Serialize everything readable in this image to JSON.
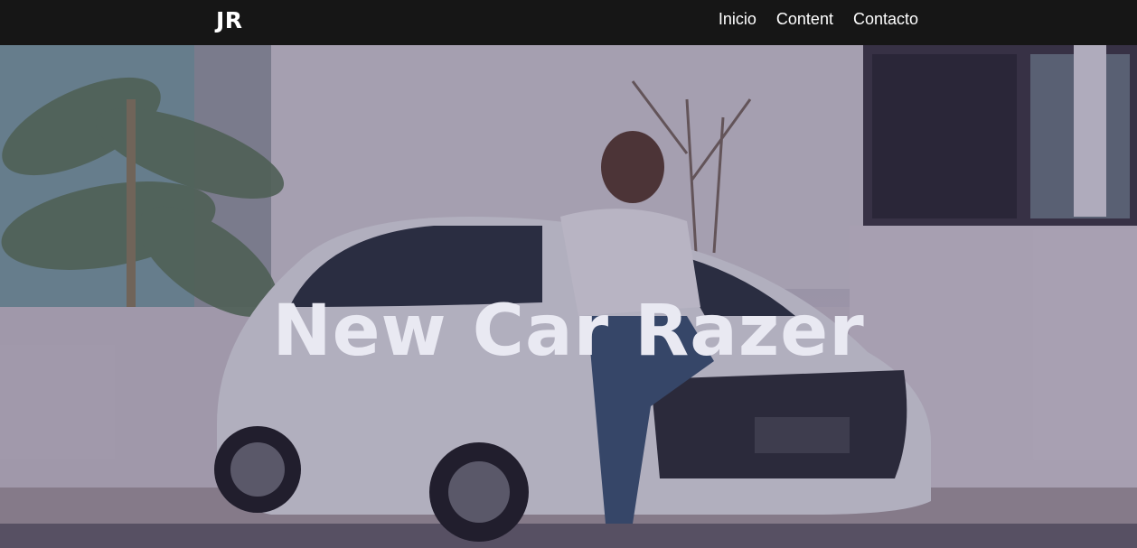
{
  "navbar": {
    "logo": "JR",
    "links": [
      {
        "label": "Inicio"
      },
      {
        "label": "Content"
      },
      {
        "label": "Contacto"
      }
    ]
  },
  "hero": {
    "title": "New Car Razer",
    "image": "car-with-woman-photo"
  },
  "colors": {
    "navbar_bg": "#161616",
    "text": "#ffffff",
    "overlay": "#281e46"
  }
}
